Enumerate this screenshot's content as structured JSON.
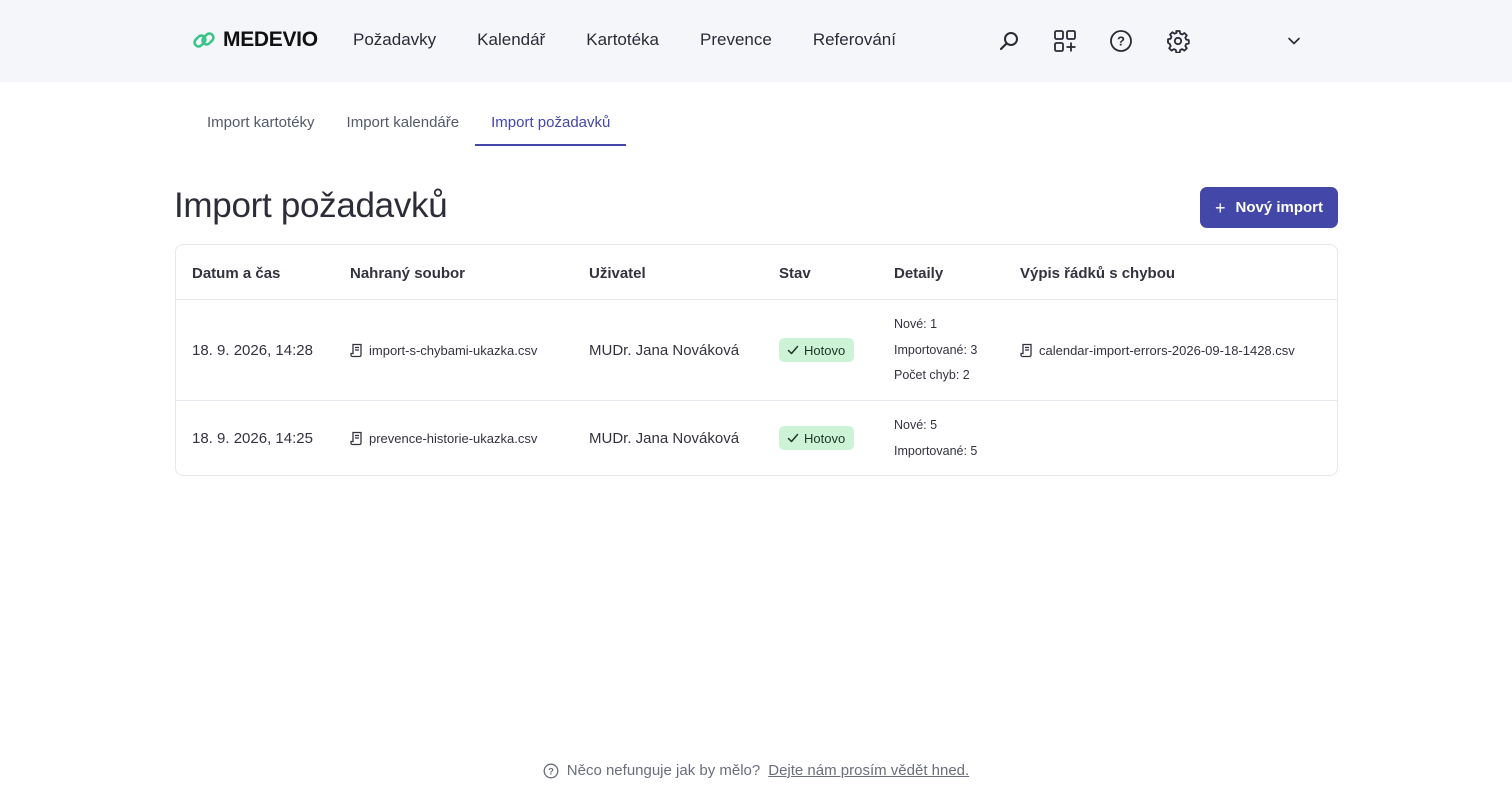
{
  "app": {
    "logo_text": "MEDEVIO"
  },
  "nav": {
    "items": [
      {
        "label": "Požadavky"
      },
      {
        "label": "Kalendář"
      },
      {
        "label": "Kartotéka"
      },
      {
        "label": "Prevence"
      },
      {
        "label": "Referování"
      }
    ]
  },
  "toolbar_icons": [
    "search-icon",
    "apps-add-icon",
    "help-icon",
    "gear-icon",
    "chevron-down-icon"
  ],
  "tabs": [
    {
      "label": "Import kartotéky",
      "active": false
    },
    {
      "label": "Import kalendáře",
      "active": false
    },
    {
      "label": "Import požadavků",
      "active": true
    }
  ],
  "page": {
    "title": "Import požadavků",
    "new_import_label": "Nový import"
  },
  "table": {
    "columns": [
      "Datum a čas",
      "Nahraný soubor",
      "Uživatel",
      "Stav",
      "Detaily",
      "Výpis řádků s chybou"
    ],
    "rows": [
      {
        "datetime": "18. 9. 2026, 14:28",
        "file": "import-s-chybami-ukazka.csv",
        "user": "MUDr. Jana Nováková",
        "status": "Hotovo",
        "details": [
          "Nové: 1",
          "Importované: 3",
          "Počet chyb: 2"
        ],
        "error_file": "calendar-import-errors-2026-09-18-1428.csv"
      },
      {
        "datetime": "18. 9. 2026, 14:25",
        "file": "prevence-historie-ukazka.csv",
        "user": "MUDr. Jana Nováková",
        "status": "Hotovo",
        "details": [
          "Nové: 5",
          "Importované: 5"
        ],
        "error_file": ""
      }
    ]
  },
  "footer": {
    "text": "Něco nefunguje jak by mělo?",
    "link": "Dejte nám prosím vědět hned."
  },
  "colors": {
    "accent": "#4347a8",
    "topbar_bg": "#f5f6f9",
    "badge_bg": "#cdf3d7",
    "logo_green": "#3ec48a"
  }
}
